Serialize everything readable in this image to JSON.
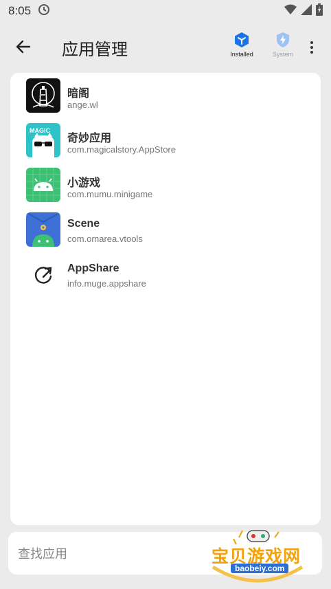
{
  "status_bar": {
    "time": "8:05"
  },
  "header": {
    "title": "应用管理",
    "tabs": [
      {
        "label": "Installed",
        "selected": true,
        "color": "#1a73e8"
      },
      {
        "label": "System",
        "selected": false,
        "color": "#9ec3f2"
      }
    ]
  },
  "apps": [
    {
      "name": "暗阁",
      "package": "ange.wl",
      "icon": "lighthouse-icon"
    },
    {
      "name": "奇妙应用",
      "package": "com.magicalstory.AppStore",
      "icon": "magic-face-icon"
    },
    {
      "name": "小游戏",
      "package": "com.mumu.minigame",
      "icon": "android-grid-icon"
    },
    {
      "name": "Scene",
      "package": "com.omarea.vtools",
      "icon": "android-gear-icon"
    },
    {
      "name": "AppShare",
      "package": "info.muge.appshare",
      "icon": "share-arrow-icon"
    }
  ],
  "search": {
    "placeholder": "查找应用"
  },
  "watermark": {
    "text": "宝贝游戏网",
    "url": "baobeiy.com"
  }
}
